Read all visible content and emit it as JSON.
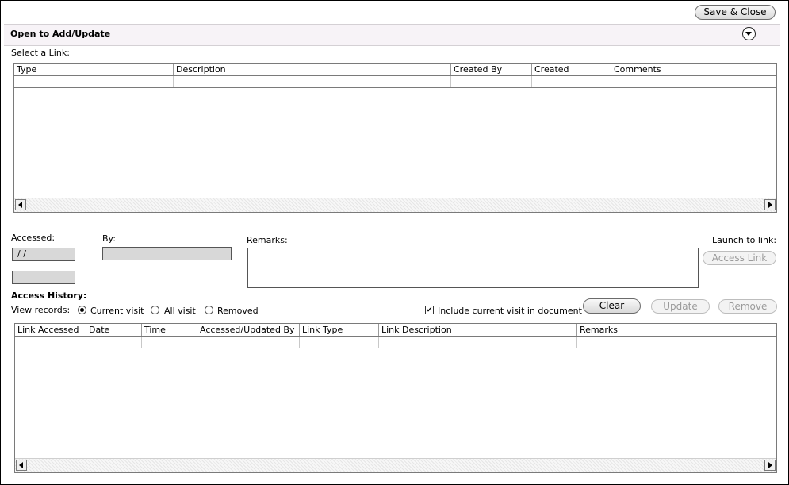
{
  "toolbar": {
    "save_close_label": "Save & Close"
  },
  "header": {
    "title": "Open to Add/Update"
  },
  "links_section": {
    "label": "Select a Link:",
    "columns": [
      "Type",
      "Description",
      "Created By",
      "Created",
      "Comments"
    ]
  },
  "accessed": {
    "label": "Accessed:",
    "date_value": " /  /",
    "time_value": ""
  },
  "by": {
    "label": "By:",
    "value": ""
  },
  "remarks": {
    "label": "Remarks:",
    "value": ""
  },
  "launch": {
    "label": "Launch to link:",
    "button_label": "Access Link"
  },
  "access_history": {
    "title": "Access History:",
    "view_label": "View records:",
    "options": [
      "Current visit",
      "All visit",
      "Removed"
    ],
    "selected": "Current visit",
    "include_label": "Include current visit in document",
    "include_checked": true,
    "clear_label": "Clear",
    "update_label": "Update",
    "remove_label": "Remove",
    "columns": [
      "Link Accessed",
      "Date",
      "Time",
      "Accessed/Updated By",
      "Link Type",
      "Link Description",
      "Remarks"
    ]
  }
}
